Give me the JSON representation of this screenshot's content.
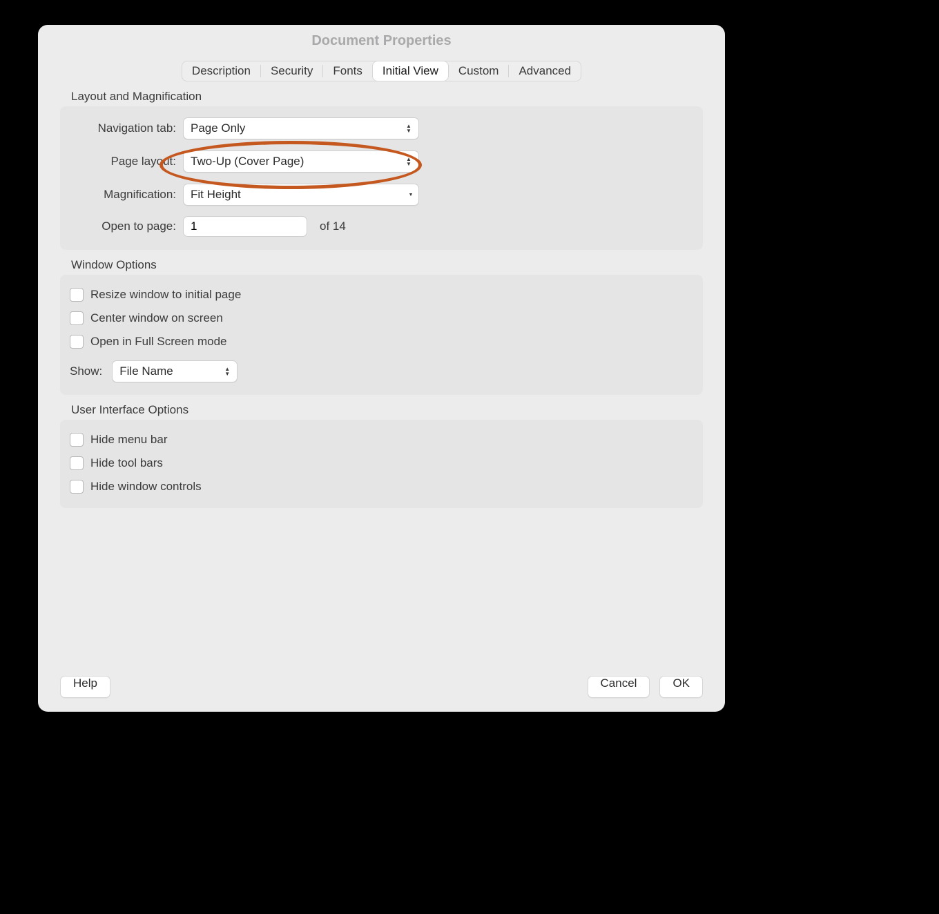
{
  "title": "Document Properties",
  "tabs": {
    "description": "Description",
    "security": "Security",
    "fonts": "Fonts",
    "initial_view": "Initial View",
    "custom": "Custom",
    "advanced": "Advanced"
  },
  "layout_section": {
    "title": "Layout and Magnification",
    "nav_label": "Navigation tab:",
    "nav_value": "Page Only",
    "page_layout_label": "Page layout:",
    "page_layout_value": "Two-Up (Cover Page)",
    "magnification_label": "Magnification:",
    "magnification_value": "Fit Height",
    "open_to_page_label": "Open to page:",
    "open_to_page_value": "1",
    "page_total_suffix": "of 14"
  },
  "window_section": {
    "title": "Window Options",
    "resize": "Resize window to initial page",
    "center": "Center window on screen",
    "fullscreen": "Open in Full Screen mode",
    "show_label": "Show:",
    "show_value": "File Name"
  },
  "ui_section": {
    "title": "User Interface Options",
    "hide_menu": "Hide menu bar",
    "hide_toolbars": "Hide tool bars",
    "hide_window_controls": "Hide window controls"
  },
  "buttons": {
    "help": "Help",
    "cancel": "Cancel",
    "ok": "OK"
  }
}
